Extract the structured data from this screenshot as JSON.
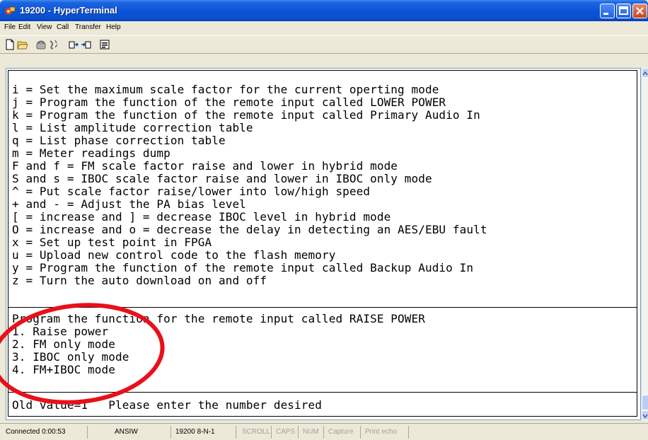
{
  "window": {
    "title": "19200 - HyperTerminal",
    "icon": "hyperterminal-app-icon",
    "buttons": [
      "minimize-icon",
      "maximize-icon",
      "close-icon"
    ]
  },
  "menubar": {
    "items": [
      "File",
      "Edit",
      "View",
      "Call",
      "Transfer",
      "Help"
    ]
  },
  "toolbar": {
    "icons": [
      "new-document-icon",
      "open-folder-icon",
      "phone-dial-icon",
      "disconnect-icon",
      "send-icon",
      "receive-icon",
      "properties-icon"
    ]
  },
  "terminal": {
    "lines": [
      "i = Set the maximum scale factor for the current operting mode",
      "j = Program the function of the remote input called LOWER POWER",
      "k = Program the function of the remote input called Primary Audio In",
      "l = List amplitude correction table",
      "q = List phase correction table",
      "m = Meter readings dump",
      "F and f = FM scale factor raise and lower in hybrid mode",
      "S and s = IBOC scale factor raise and lower in IBOC only mode",
      "^ = Put scale factor raise/lower into low/high speed",
      "+ and - = Adjust the PA bias level",
      "[ = increase and ] = decrease IBOC level in hybrid mode",
      "O = increase and o = decrease the delay in detecting an AES/EBU fault",
      "x = Set up test point in FPGA",
      "u = Upload new control code to the flash memory",
      "y = Program the function of the remote input called Backup Audio In",
      "z = Turn the auto download on and off",
      "",
      "Program the function for the remote input called RAISE POWER",
      "1. Raise power",
      "2. FM only mode",
      "3. IBOC only mode",
      "4. FM+IBOC mode",
      "",
      "Old value=1   Please enter the number desired"
    ]
  },
  "statusbar": {
    "connected": "Connected 0:00:53",
    "emulation": "ANSIW",
    "port_settings": "19200 8-N-1",
    "scroll": "SCROLL",
    "caps": "CAPS",
    "num": "NUM",
    "capture": "Capture",
    "print_echo": "Print echo"
  },
  "annotation": {
    "color": "#e8101a"
  }
}
